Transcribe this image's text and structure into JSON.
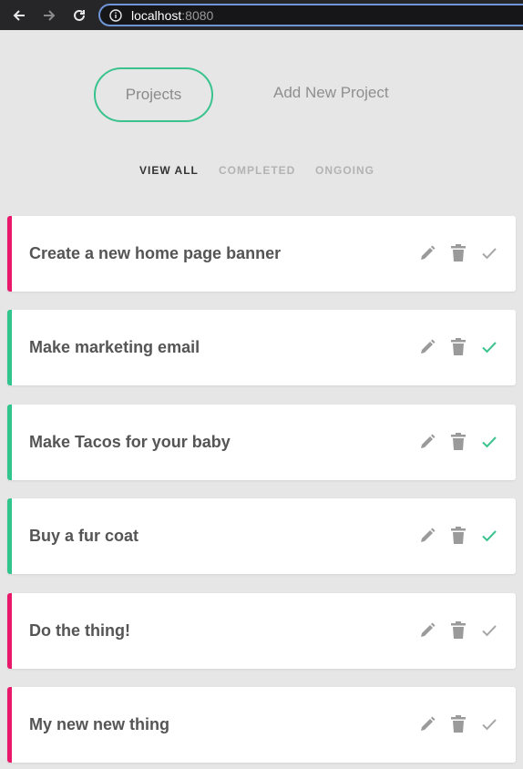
{
  "browser": {
    "url_host": "localhost",
    "url_port": ":8080"
  },
  "header": {
    "projects_label": "Projects",
    "add_project_label": "Add New Project"
  },
  "filters": {
    "view_all": "VIEW ALL",
    "completed": "COMPLETED",
    "ongoing": "ONGOING"
  },
  "colors": {
    "accent_green": "#3ac38e",
    "ongoing_pink": "#e9186a"
  },
  "projects": [
    {
      "title": "Create a new home page banner",
      "complete": false
    },
    {
      "title": "Make marketing email",
      "complete": true
    },
    {
      "title": "Make Tacos for your baby",
      "complete": true
    },
    {
      "title": "Buy a fur coat",
      "complete": true
    },
    {
      "title": "Do the thing!",
      "complete": false
    },
    {
      "title": "My new new thing",
      "complete": false
    }
  ]
}
